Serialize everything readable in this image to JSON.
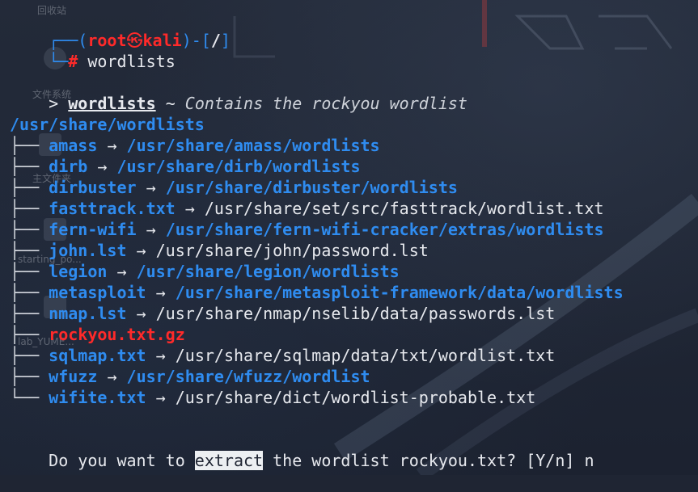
{
  "prompt": {
    "frame_left": "┌──(",
    "user": "root",
    "at_symbol": "㉿",
    "host": "kali",
    "frame_mid": ")-[",
    "cwd": "/",
    "frame_right": "]",
    "frame_bottom": "└─",
    "hash": "#",
    "command": "wordlists"
  },
  "header": {
    "arrow": ">",
    "name": "wordlists",
    "sep": "~",
    "description": "Contains the rockyou wordlist"
  },
  "root_dir": "/usr/share/wordlists",
  "entries": [
    {
      "branch": "├──",
      "name": "amass",
      "arrow": "→",
      "target": "/usr/share/amass/wordlists",
      "target_is_dir": true
    },
    {
      "branch": "├──",
      "name": "dirb",
      "arrow": "→",
      "target": "/usr/share/dirb/wordlists",
      "target_is_dir": true
    },
    {
      "branch": "├──",
      "name": "dirbuster",
      "arrow": "→",
      "target": "/usr/share/dirbuster/wordlists",
      "target_is_dir": true
    },
    {
      "branch": "├──",
      "name": "fasttrack.txt",
      "arrow": "→",
      "target": "/usr/share/set/src/fasttrack/wordlist.txt",
      "target_is_dir": false
    },
    {
      "branch": "├──",
      "name": "fern-wifi",
      "arrow": "→",
      "target": "/usr/share/fern-wifi-cracker/extras/wordlists",
      "target_is_dir": true
    },
    {
      "branch": "├──",
      "name": "john.lst",
      "arrow": "→",
      "target": "/usr/share/john/password.lst",
      "target_is_dir": false
    },
    {
      "branch": "├──",
      "name": "legion",
      "arrow": "→",
      "target": "/usr/share/legion/wordlists",
      "target_is_dir": true
    },
    {
      "branch": "├──",
      "name": "metasploit",
      "arrow": "→",
      "target": "/usr/share/metasploit-framework/data/wordlists",
      "target_is_dir": true
    },
    {
      "branch": "├──",
      "name": "nmap.lst",
      "arrow": "→",
      "target": "/usr/share/nmap/nselib/data/passwords.lst",
      "target_is_dir": false
    },
    {
      "branch": "├──",
      "name": "rockyou.txt.gz",
      "arrow": "",
      "target": "",
      "target_is_dir": false,
      "archive": true
    },
    {
      "branch": "├──",
      "name": "sqlmap.txt",
      "arrow": "→",
      "target": "/usr/share/sqlmap/data/txt/wordlist.txt",
      "target_is_dir": false
    },
    {
      "branch": "├──",
      "name": "wfuzz",
      "arrow": "→",
      "target": "/usr/share/wfuzz/wordlist",
      "target_is_dir": true
    },
    {
      "branch": "└──",
      "name": "wifite.txt",
      "arrow": "→",
      "target": "/usr/share/dict/wordlist-probable.txt",
      "target_is_dir": false
    }
  ],
  "question": {
    "before": "Do you want to ",
    "highlight": "extract",
    "after": " the wordlist rockyou.txt? [Y/n] ",
    "answer": "n"
  },
  "desktop": {
    "labels": [
      "回收站",
      "文件系统",
      "主文件夹",
      "starting_po...",
      "lab_YUME..."
    ]
  },
  "colors": {
    "background": "#1f2533",
    "red": "#ff2a2a",
    "blue": "#2f8cf0",
    "text": "#e7e9ee"
  }
}
